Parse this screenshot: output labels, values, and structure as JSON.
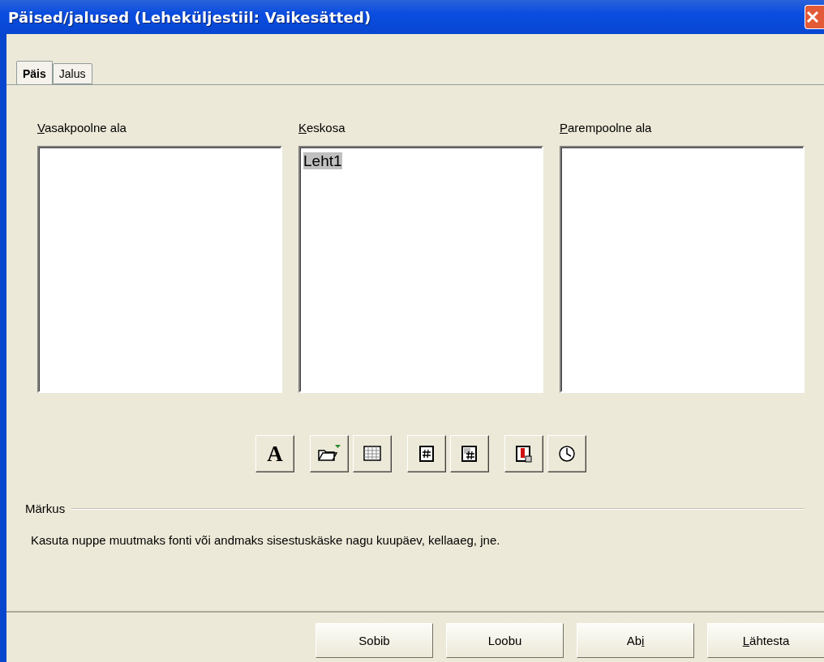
{
  "window": {
    "title": "Päised/jalused (Leheküljestiil: Vaikesätted)"
  },
  "tabs": [
    {
      "label": "Päis",
      "selected": true
    },
    {
      "label": "Jalus",
      "selected": false
    }
  ],
  "areas": [
    {
      "label": {
        "key": "V",
        "after": "asakpoolne ala"
      }
    },
    {
      "label": {
        "key": "K",
        "after": "eskosa"
      },
      "content": {
        "text": "Leht1",
        "highlighted": true
      }
    },
    {
      "label": {
        "key": "P",
        "after": "arempoolne ala"
      }
    }
  ],
  "tools": [
    {
      "kind": "font",
      "label": "A"
    },
    {
      "kind": "file"
    },
    {
      "kind": "sheet"
    },
    {
      "kind": "page"
    },
    {
      "kind": "pages"
    },
    {
      "kind": "date"
    },
    {
      "kind": "time"
    }
  ],
  "note": {
    "title": "Märkus",
    "text": "Kasuta nuppe muutmaks fonti või andmaks sisestuskäske nagu kuupäev, kellaaeg, jne."
  },
  "buttons": [
    {
      "label": {
        "after": "Sobib"
      }
    },
    {
      "label": {
        "after": "Loobu"
      }
    },
    {
      "label": {
        "before": "Ab",
        "key": "i"
      }
    },
    {
      "label": {
        "key": "L",
        "after": "ähtesta"
      }
    }
  ]
}
